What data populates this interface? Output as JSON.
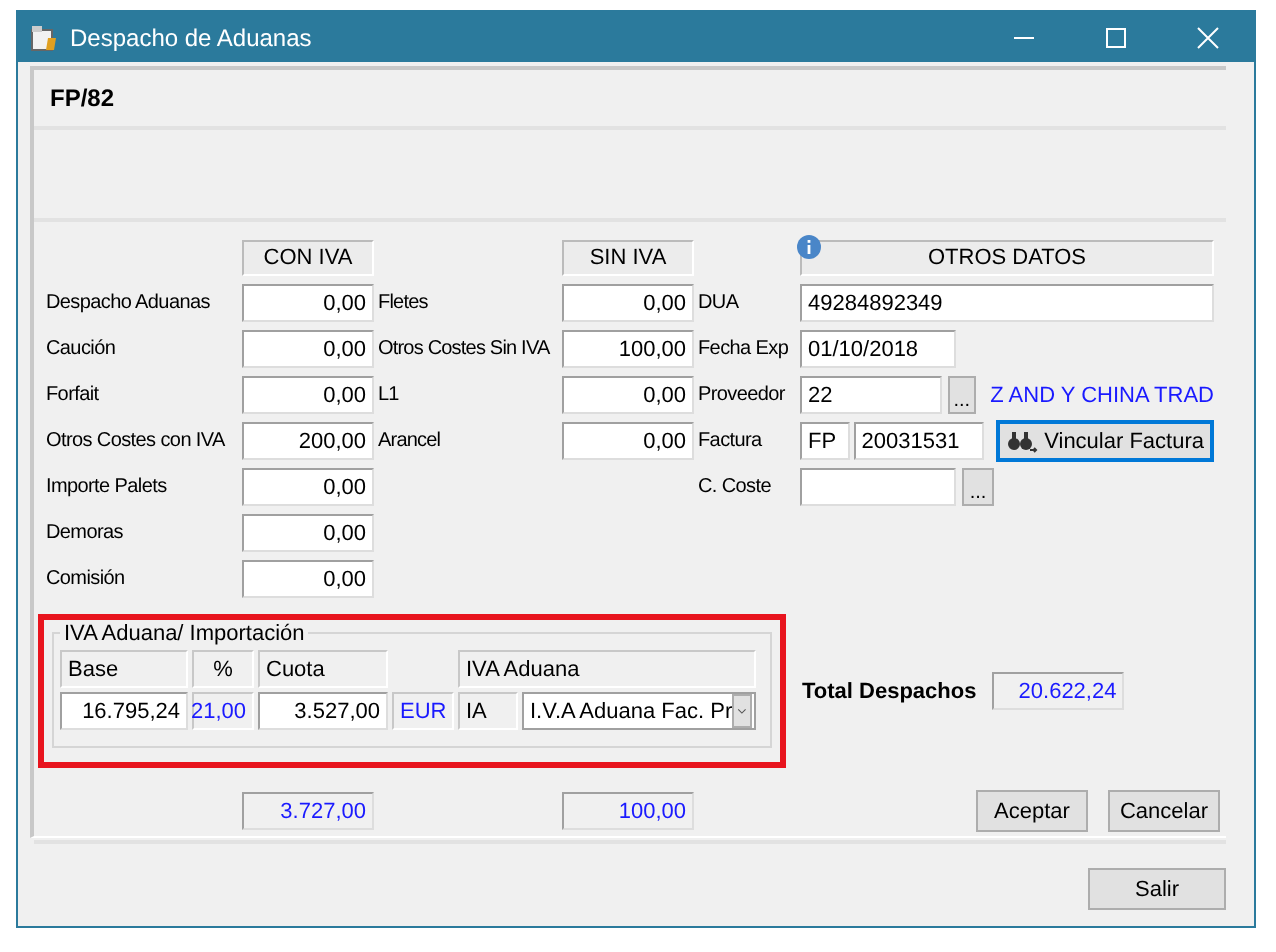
{
  "window": {
    "title": "Despacho de Aduanas"
  },
  "header": {
    "code": "FP/82"
  },
  "column_headers": [
    "CON IVA",
    "SIN IVA",
    "OTROS DATOS"
  ],
  "con_iva": [
    {
      "label": "Despacho Aduanas",
      "value": "0,00"
    },
    {
      "label": "Caución",
      "value": "0,00"
    },
    {
      "label": "Forfait",
      "value": "0,00"
    },
    {
      "label": "Otros Costes con IVA",
      "value": "200,00"
    },
    {
      "label": "Importe Palets",
      "value": "0,00"
    },
    {
      "label": "Demoras",
      "value": "0,00"
    },
    {
      "label": "Comisión",
      "value": "0,00"
    }
  ],
  "sin_iva": [
    {
      "label": "Fletes",
      "value": "0,00"
    },
    {
      "label": "Otros Costes Sin IVA",
      "value": "100,00"
    },
    {
      "label": "L1",
      "value": "0,00"
    },
    {
      "label": "Arancel",
      "value": "0,00"
    }
  ],
  "otros_datos": [
    {
      "kind": "wide_field",
      "label": "DUA",
      "value": "49284892349"
    },
    {
      "kind": "field",
      "label": "Fecha Exp",
      "value": "01/10/2018"
    },
    {
      "kind": "lookup",
      "label": "Proveedor",
      "value": "22",
      "button": "...",
      "note": "Z AND Y CHINA TRAD"
    },
    {
      "kind": "invoice",
      "label": "Factura",
      "series": "FP",
      "number": "20031531",
      "button": "Vincular Factura"
    },
    {
      "kind": "lookup",
      "label": "C. Coste",
      "button": "..."
    }
  ],
  "iva_aduana": {
    "title": "IVA Aduana/ Importación",
    "columns": [
      "Base",
      "%",
      "Cuota",
      "IVA Aduana"
    ],
    "base": "16.795,24",
    "percent": "21,00",
    "cuota": "3.527,00",
    "currency": "EUR",
    "code": "IA",
    "type": "I.V.A Aduana Fac. Pr"
  },
  "total_despachos": {
    "label": "Total Despachos",
    "value": "20.622,24"
  },
  "totals": {
    "con_iva": "3.727,00",
    "sin_iva": "100,00"
  },
  "buttons": [
    "Aceptar",
    "Cancelar"
  ],
  "exit_button": "Salir"
}
